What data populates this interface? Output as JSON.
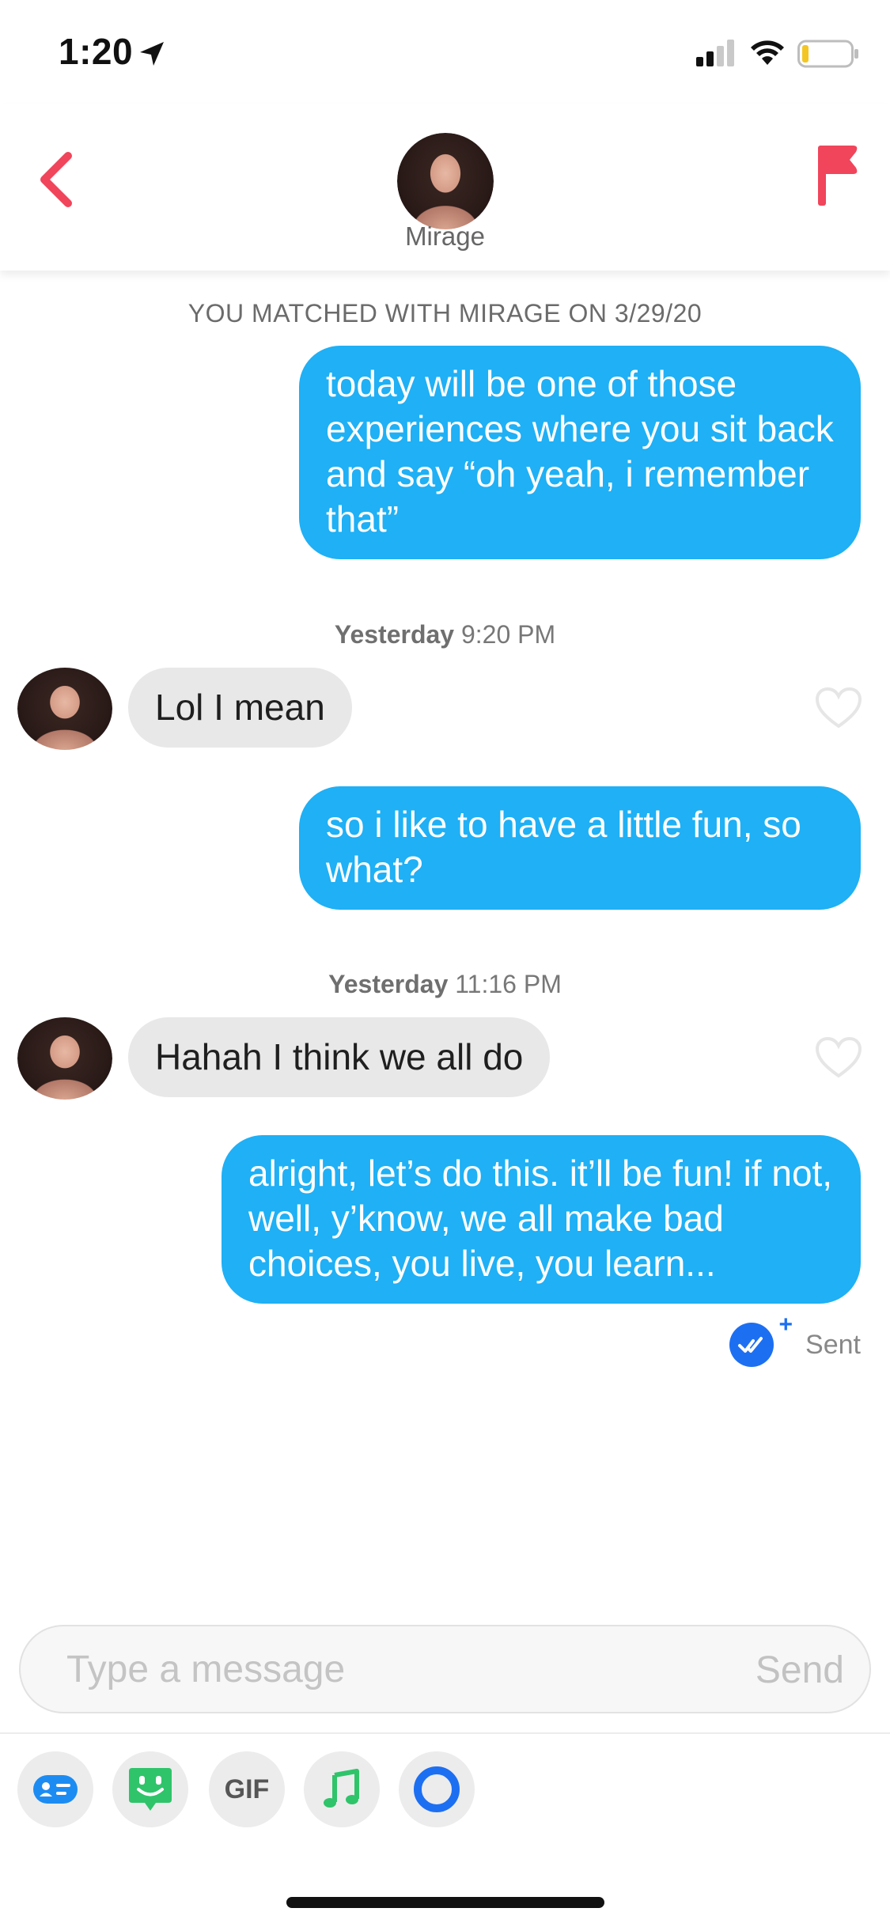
{
  "status_bar": {
    "time": "1:20",
    "icons": [
      "location-arrow-icon",
      "cellular-signal-icon",
      "wifi-icon",
      "battery-icon"
    ]
  },
  "header": {
    "name": "Mirage",
    "icons": [
      "back-chevron-icon",
      "report-flag-icon"
    ],
    "accent_color": "#f0455b"
  },
  "chat": {
    "match_banner": "YOU MATCHED WITH MIRAGE ON 3/29/20",
    "messages": [
      {
        "direction": "out",
        "text": "today will be one of those experiences where you sit back and say “oh yeah, i remember that”"
      },
      {
        "type": "timestamp",
        "day": "Yesterday",
        "time": "9:20 PM"
      },
      {
        "direction": "in",
        "text": "Lol I mean"
      },
      {
        "direction": "out",
        "text": "so i like to have a little fun, so what?"
      },
      {
        "type": "timestamp",
        "day": "Yesterday",
        "time": "11:16 PM"
      },
      {
        "direction": "in",
        "text": "Hahah I think we all do"
      },
      {
        "direction": "out",
        "text": "alright, let’s do this. it’ll be fun! if not, well, y’know, we all make bad choices, you live, you learn..."
      }
    ],
    "sent_status": "Sent",
    "outgoing_color": "#1fb0f5",
    "incoming_color": "#e8e8e8"
  },
  "composer": {
    "placeholder": "Type a message",
    "send_label": "Send"
  },
  "toolbar": {
    "gif_label": "GIF",
    "icons": [
      "contact-card-icon",
      "sticker-icon",
      "gif-icon",
      "music-note-icon",
      "loading-ring-icon"
    ]
  }
}
